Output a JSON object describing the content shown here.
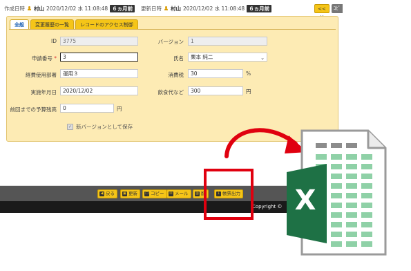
{
  "meta": {
    "created_label": "作成日時",
    "created_user": "村山",
    "created_date": "2020/12/02 水 11:08:48",
    "created_ago": "６ヵ月前",
    "updated_label": "更新日時",
    "updated_user": "村山",
    "updated_date": "2020/12/02 水 11:08:48",
    "updated_ago": "６ヵ月前"
  },
  "header_buttons": {
    "prev": "<< 前",
    "other": "ｺﾋﾟ"
  },
  "tabs": [
    {
      "label": "全般",
      "active": true
    },
    {
      "label": "変更履歴の一覧",
      "active": false
    },
    {
      "label": "レコードのアクセス制御",
      "active": false
    }
  ],
  "form": {
    "id": {
      "label": "ID",
      "value": "3775"
    },
    "version": {
      "label": "バージョン",
      "value": "1"
    },
    "app_no": {
      "label": "申請番号",
      "required_mark": "*",
      "value": "3"
    },
    "name": {
      "label": "氏名",
      "value": "栗本 純二"
    },
    "dept": {
      "label": "経費使用部署",
      "value": "運用３"
    },
    "tax": {
      "label": "消費税",
      "value": "30",
      "unit": "%"
    },
    "date": {
      "label": "実施年月日",
      "value": "2020/12/02"
    },
    "food": {
      "label": "飲食代など",
      "value": "300",
      "unit": "円"
    },
    "prev_budget": {
      "label": "前回までの予算残高",
      "value": "0",
      "unit": "円"
    },
    "save_new_version": {
      "label": "新バージョンとして保存",
      "checked": true
    }
  },
  "toolbar": [
    {
      "name": "back-button",
      "label": "戻る",
      "icon": "back-icon",
      "glyph": "◀"
    },
    {
      "name": "update-button",
      "label": "更新",
      "icon": "save-icon",
      "glyph": "▣"
    },
    {
      "name": "copy-button",
      "label": "コピー",
      "icon": "copy-icon",
      "glyph": "❐"
    },
    {
      "name": "mail-button",
      "label": "メール",
      "icon": "mail-icon",
      "glyph": "✉"
    },
    {
      "name": "delete-button",
      "label": "削",
      "icon": "trash-icon",
      "glyph": "▥"
    },
    {
      "name": "export-button",
      "label": "帳票出力",
      "icon": "download-icon",
      "glyph": "↓"
    }
  ],
  "footer": {
    "copyright": "Copyright ©"
  },
  "excel_icon": {
    "letter": "X"
  },
  "colors": {
    "panel_bg": "#fdebb4",
    "accent_yellow": "#f5c518",
    "highlight_red": "#e0000f",
    "excel_green": "#1e7145",
    "arrow_red": "#e0000f"
  }
}
